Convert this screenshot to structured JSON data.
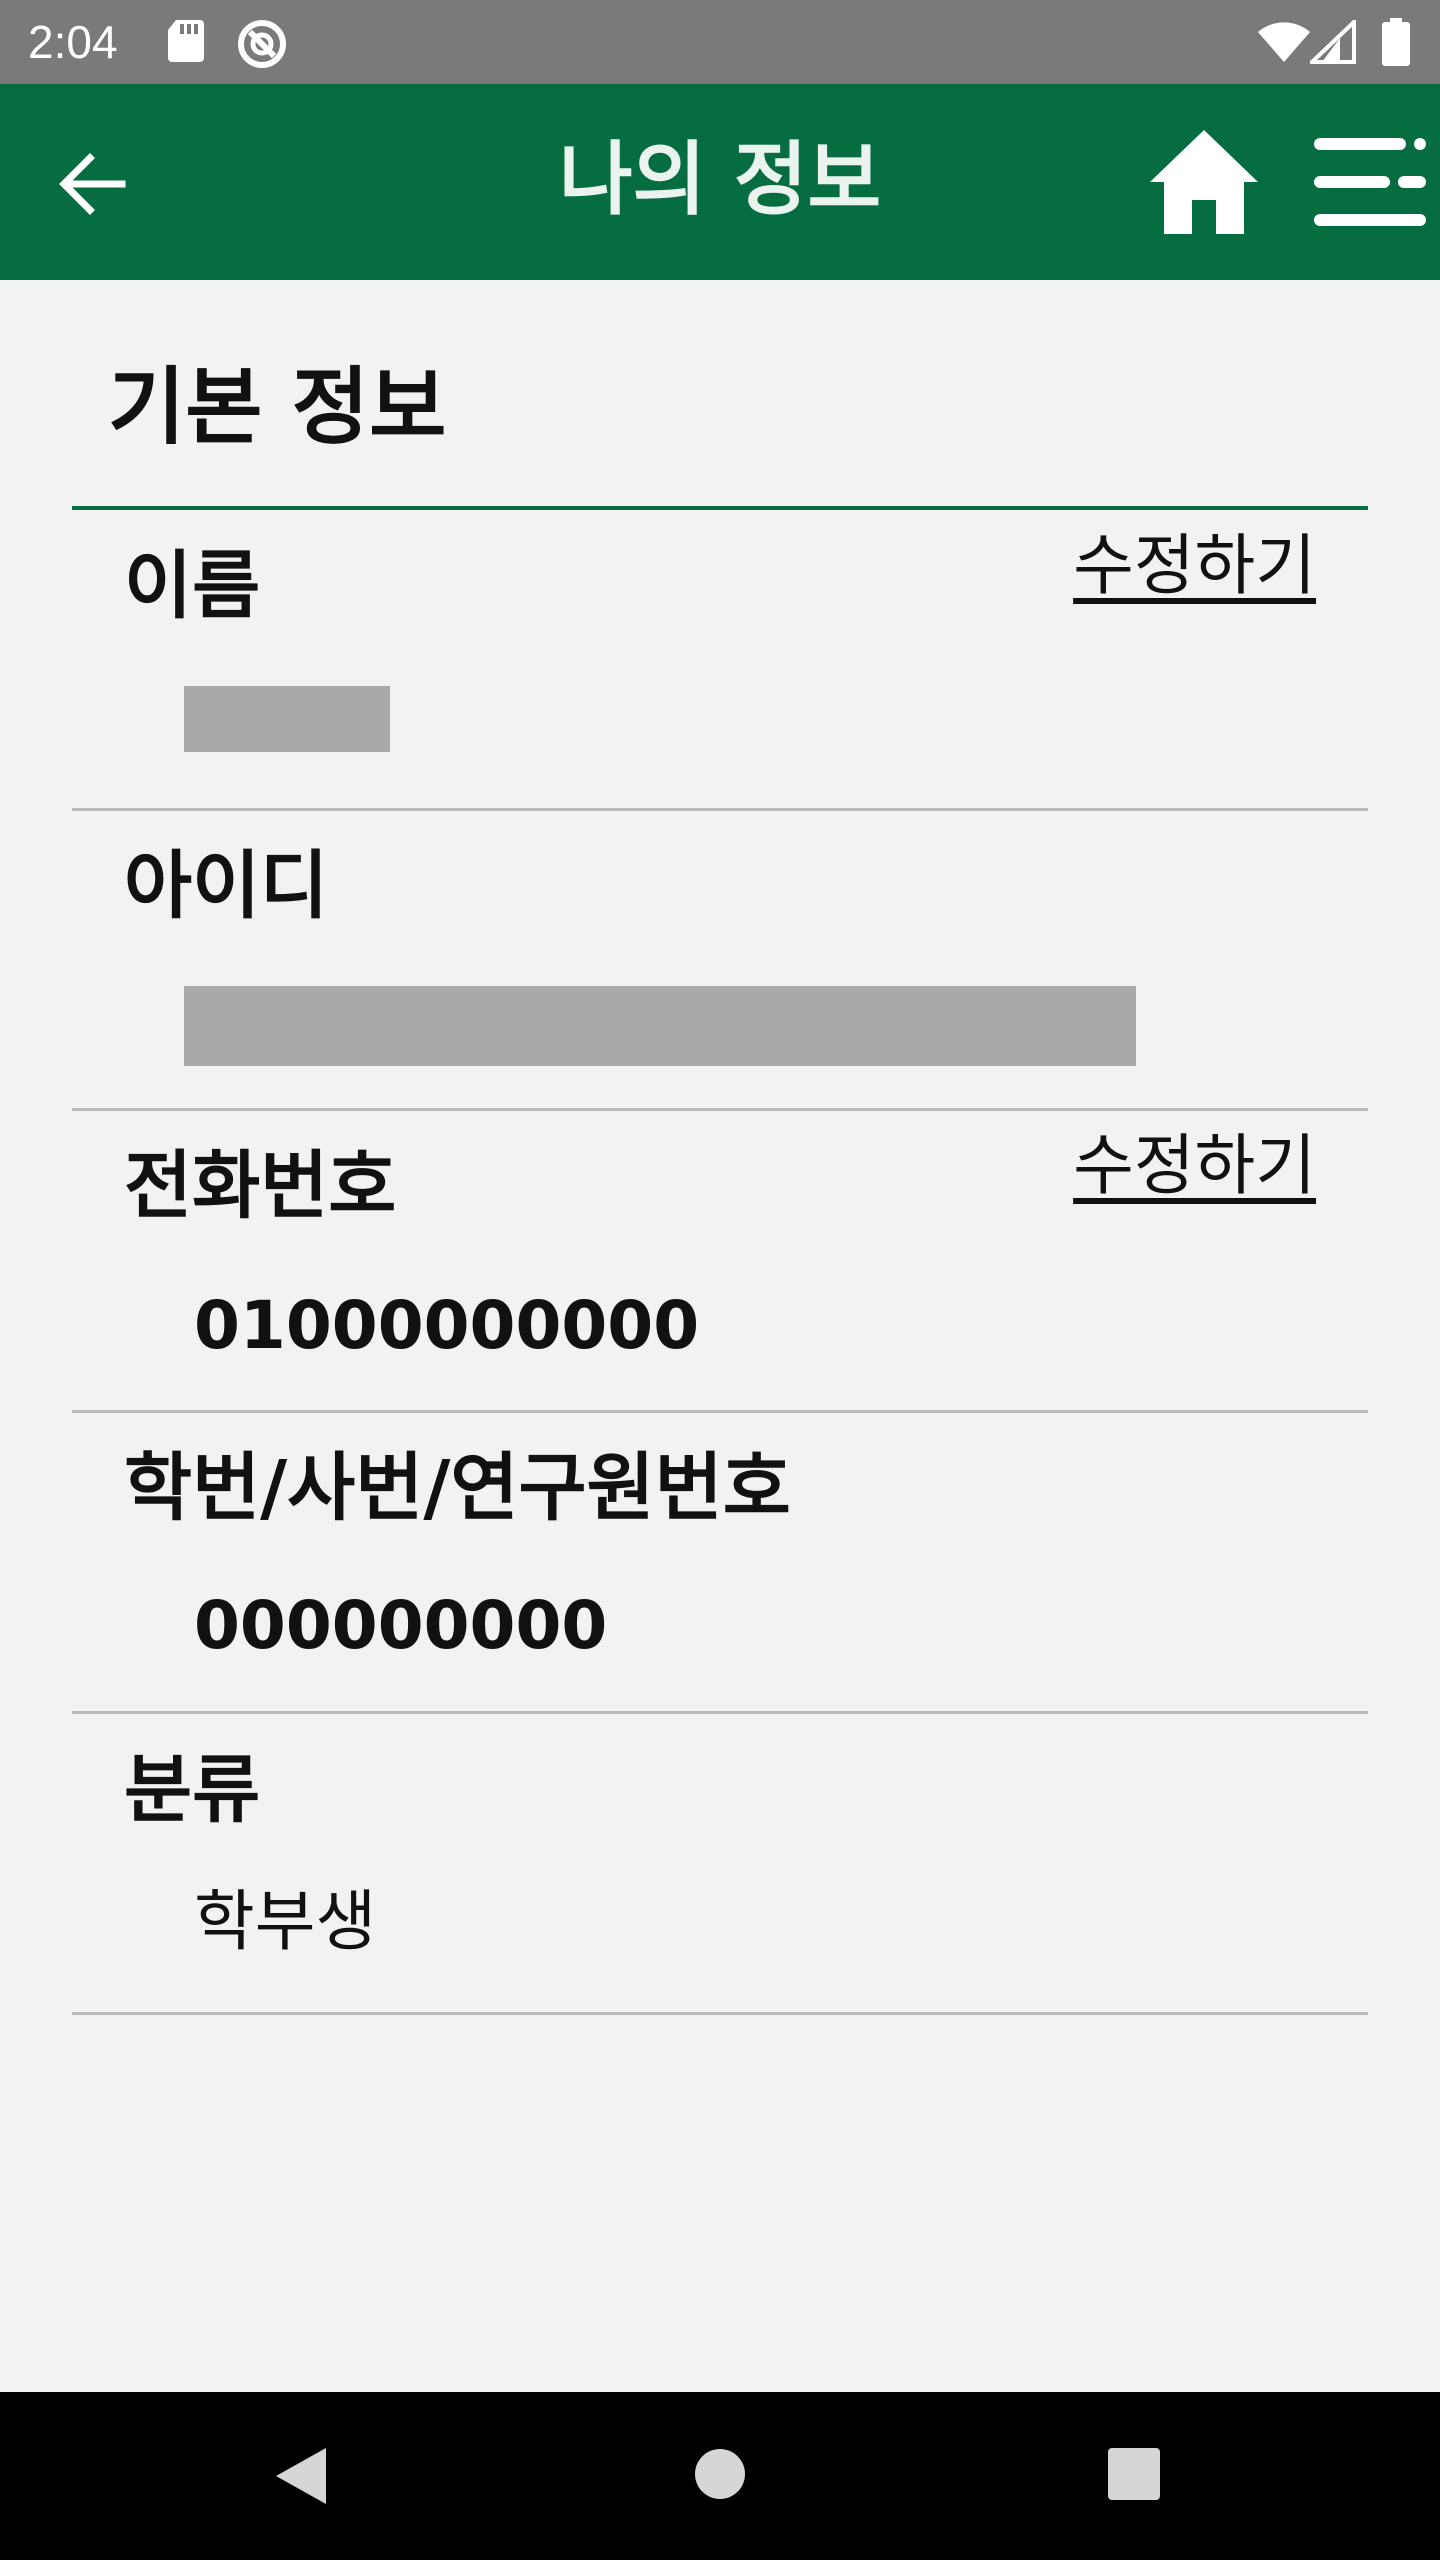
{
  "status_bar": {
    "time": "2:04"
  },
  "app_bar": {
    "title": "나의 정보"
  },
  "section": {
    "title": "기본 정보"
  },
  "fields": {
    "name": {
      "label": "이름",
      "edit": "수정하기"
    },
    "id": {
      "label": "아이디"
    },
    "phone": {
      "label": "전화번호",
      "value": "01000000000",
      "edit": "수정하기"
    },
    "number": {
      "label": "학번/사번/연구원번호",
      "value": "000000000"
    },
    "category": {
      "label": "분류",
      "value": "학부생"
    }
  },
  "colors": {
    "brand": "#066d41",
    "background": "#f2f2f2",
    "status_bar": "#7a7a7a"
  }
}
